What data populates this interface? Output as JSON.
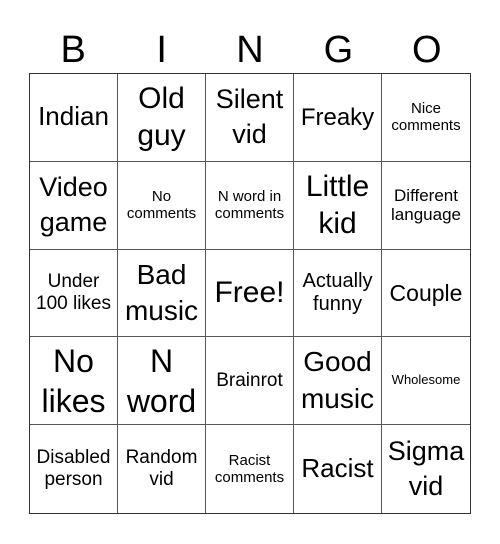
{
  "header": [
    "B",
    "I",
    "N",
    "G",
    "O"
  ],
  "cells": [
    "Indian",
    "Old guy",
    "Silent vid",
    "Freaky",
    "Nice comments",
    "Video game",
    "No comments",
    "N word in comments",
    "Little kid",
    "Different language",
    "Under 100 likes",
    "Bad music",
    "Free!",
    "Actually funny",
    "Couple",
    "No likes",
    "N word",
    "Brainrot",
    "Good music",
    "Wholesome",
    "Disabled person",
    "Random vid",
    "Racist comments",
    "Racist",
    "Sigma vid"
  ]
}
